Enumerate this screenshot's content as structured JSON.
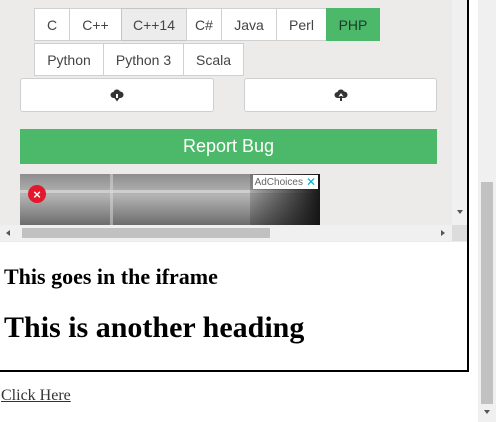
{
  "compiler_panel": {
    "language_tabs_row1": [
      {
        "label": "C",
        "state": "normal"
      },
      {
        "label": "C++",
        "state": "normal"
      },
      {
        "label": "C++14",
        "state": "active"
      },
      {
        "label": "C#",
        "state": "normal"
      },
      {
        "label": "Java",
        "state": "normal"
      },
      {
        "label": "Perl",
        "state": "normal"
      },
      {
        "label": "PHP",
        "state": "selected"
      }
    ],
    "language_tabs_row2": [
      {
        "label": "Python",
        "state": "normal"
      },
      {
        "label": "Python 3",
        "state": "normal"
      },
      {
        "label": "Scala",
        "state": "normal"
      }
    ],
    "download_icon": "cloud-download-icon",
    "upload_icon": "cloud-upload-icon",
    "report_bug_label": "Report Bug",
    "colors": {
      "accent_green": "#4cb86a",
      "panel_bg": "#ecebe9"
    },
    "ad": {
      "choices_label": "AdChoices",
      "close_glyph": "✕"
    }
  },
  "iframe_content": {
    "heading_small": "This goes in the iframe",
    "heading_large": "This is another heading"
  },
  "page": {
    "link_label": "Click Here"
  }
}
